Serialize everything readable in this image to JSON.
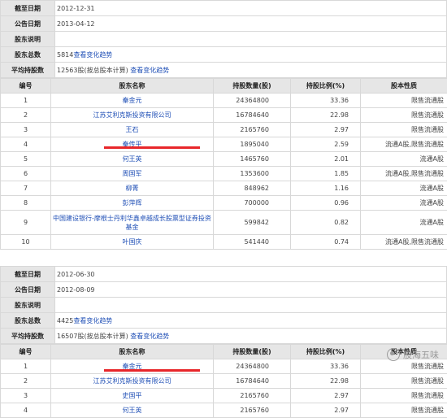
{
  "labels": {
    "deadline": "截至日期",
    "announce": "公告日期",
    "explain": "股东说明",
    "total": "股东总数",
    "average": "平均持股数"
  },
  "columns": [
    "编号",
    "股东名称",
    "持股数量(股)",
    "持股比例(%)",
    "股本性质"
  ],
  "sections": [
    {
      "deadline": "2012-12-31",
      "announce": "2013-04-12",
      "explain": "",
      "total": "5814",
      "total_link": "查看变化趋势",
      "average": "12563股(按总股本计算)",
      "average_link": "查看变化趋势",
      "rows": [
        {
          "no": "1",
          "name": "秦金元",
          "shares": "24364800",
          "ratio": "33.36",
          "nature": "限售流通股"
        },
        {
          "no": "2",
          "name": "江苏艾利克斯投资有限公司",
          "shares": "16784640",
          "ratio": "22.98",
          "nature": "限售流通股"
        },
        {
          "no": "3",
          "name": "王石",
          "shares": "2165760",
          "ratio": "2.97",
          "nature": "限售流通股"
        },
        {
          "no": "4",
          "name": "秦传平",
          "shares": "1895040",
          "ratio": "2.59",
          "nature": "流通A股,限售流通股"
        },
        {
          "no": "5",
          "name": "何王英",
          "shares": "1465760",
          "ratio": "2.01",
          "nature": "流通A股"
        },
        {
          "no": "6",
          "name": "周国军",
          "shares": "1353600",
          "ratio": "1.85",
          "nature": "流通A股,限售流通股"
        },
        {
          "no": "7",
          "name": "柳菁",
          "shares": "848962",
          "ratio": "1.16",
          "nature": "流通A股"
        },
        {
          "no": "8",
          "name": "彭萍辉",
          "shares": "700000",
          "ratio": "0.96",
          "nature": "流通A股"
        },
        {
          "no": "9",
          "name": "中国建设银行-摩根士丹利华鑫卓越成长股票型证券投资基金",
          "shares": "599842",
          "ratio": "0.82",
          "nature": "流通A股"
        },
        {
          "no": "10",
          "name": "叶国庆",
          "shares": "541440",
          "ratio": "0.74",
          "nature": "流通A股,限售流通股"
        }
      ]
    },
    {
      "deadline": "2012-06-30",
      "announce": "2012-08-09",
      "explain": "",
      "total": "4425",
      "total_link": "查看变化趋势",
      "average": "16507股(按总股本计算)",
      "average_link": "查看变化趋势",
      "rows": [
        {
          "no": "1",
          "name": "秦金元",
          "shares": "24364800",
          "ratio": "33.36",
          "nature": "限售流通股"
        },
        {
          "no": "2",
          "name": "江苏艾利克斯投资有限公司",
          "shares": "16784640",
          "ratio": "22.98",
          "nature": "限售流通股"
        },
        {
          "no": "3",
          "name": "史国平",
          "shares": "2165760",
          "ratio": "2.97",
          "nature": "限售流通股"
        },
        {
          "no": "4",
          "name": "何王英",
          "shares": "2165760",
          "ratio": "2.97",
          "nature": "限售流通股"
        }
      ]
    }
  ],
  "watermark": "股海五味",
  "colors": {
    "link": "#1f4fb6",
    "highlight": "#e8262a",
    "header_bg": "#e6e6e6"
  }
}
